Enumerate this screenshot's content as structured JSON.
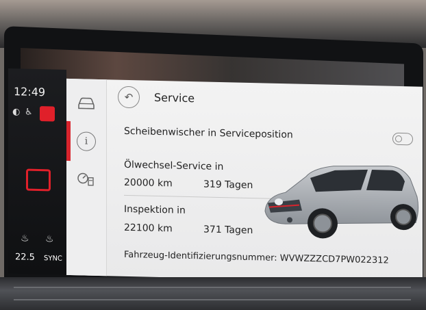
{
  "left_strip": {
    "clock": "12:49",
    "temperature": "22.5",
    "sync_label": "SYNC"
  },
  "side_menu": {
    "items": [
      {
        "icon": "car-icon"
      },
      {
        "icon": "info-icon"
      },
      {
        "icon": "fuel-gauge-icon"
      }
    ],
    "active_index": 1
  },
  "header": {
    "title": "Service"
  },
  "wiper": {
    "label": "Scheibenwischer in Serviceposition",
    "toggle_on": false
  },
  "oil_service": {
    "label": "Ölwechsel-Service in",
    "distance": "20000 km",
    "days": "319 Tagen"
  },
  "inspection": {
    "label": "Inspektion in",
    "distance": "22100 km",
    "days": "371 Tagen"
  },
  "vin": "Fahrzeug-Identifizierungsnummer: WVWZZZCD7PW022312",
  "colors": {
    "accent_red": "#d8242d",
    "car_body": "#aeb3b8"
  }
}
